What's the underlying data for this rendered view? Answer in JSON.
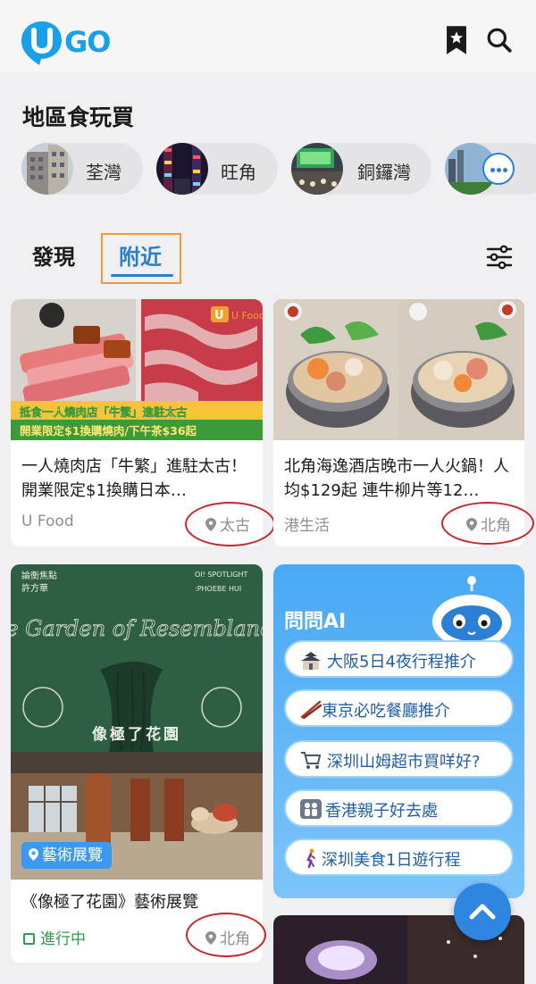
{
  "app": {
    "logo_text": "UGO"
  },
  "header": {
    "bookmark_icon": "bookmark-icon",
    "search_icon": "search-icon"
  },
  "section": {
    "title": "地區食玩買"
  },
  "districts": [
    {
      "label": "荃灣"
    },
    {
      "label": "旺角"
    },
    {
      "label": "銅鑼灣"
    },
    {
      "label": ""
    }
  ],
  "more_icon": "more-horizontal-icon",
  "tabs": [
    {
      "label": "發現",
      "active": false
    },
    {
      "label": "附近",
      "active": true
    }
  ],
  "filter_icon": "sliders-icon",
  "feed": {
    "card1": {
      "image_caption_line1": "抵食一人燒肉店「牛繁」進駐太古",
      "image_caption_line2": "開業限定$1換購燒肉/下午茶$36起",
      "image_brand": "U Food",
      "title": "一人燒肉店「牛繁」進駐太古！開業限定$1換購日本…",
      "source": "U Food",
      "location": "太古"
    },
    "card2": {
      "title": "北角海逸酒店晚市一人火鍋！人均$129起 連牛柳片等12…",
      "source": "港生活",
      "location": "北角"
    },
    "card3": {
      "poster_top_left": "論衡焦點",
      "poster_top_left2": "許方華",
      "poster_top_right": "OI! SPOTLIGHT",
      "poster_top_right2": ":PHOEBE HUI",
      "poster_title": "The Garden of Resemblances",
      "poster_subtitle": "像極了花園",
      "tag": "藝術展覽",
      "title": "《像極了花園》藝術展覽",
      "status": "進行中",
      "location": "北角"
    },
    "ai_card": {
      "title": "問問AI",
      "prompts": [
        {
          "icon": "castle-icon",
          "text": "大阪5日4夜行程推介"
        },
        {
          "icon": "chopsticks-icon",
          "text": "東京必吃餐廳推介"
        },
        {
          "icon": "shopping-cart-icon",
          "text": "深圳山姆超市買咩好?"
        },
        {
          "icon": "family-icon",
          "text": "香港親子好去處"
        },
        {
          "icon": "walking-person-icon",
          "text": "深圳美食1日遊行程"
        }
      ]
    }
  },
  "colors": {
    "brand_blue": "#2b7fd0",
    "highlight_orange": "#f39a3c",
    "annotation_red": "#c42a2a",
    "status_green": "#2e9b4e"
  }
}
